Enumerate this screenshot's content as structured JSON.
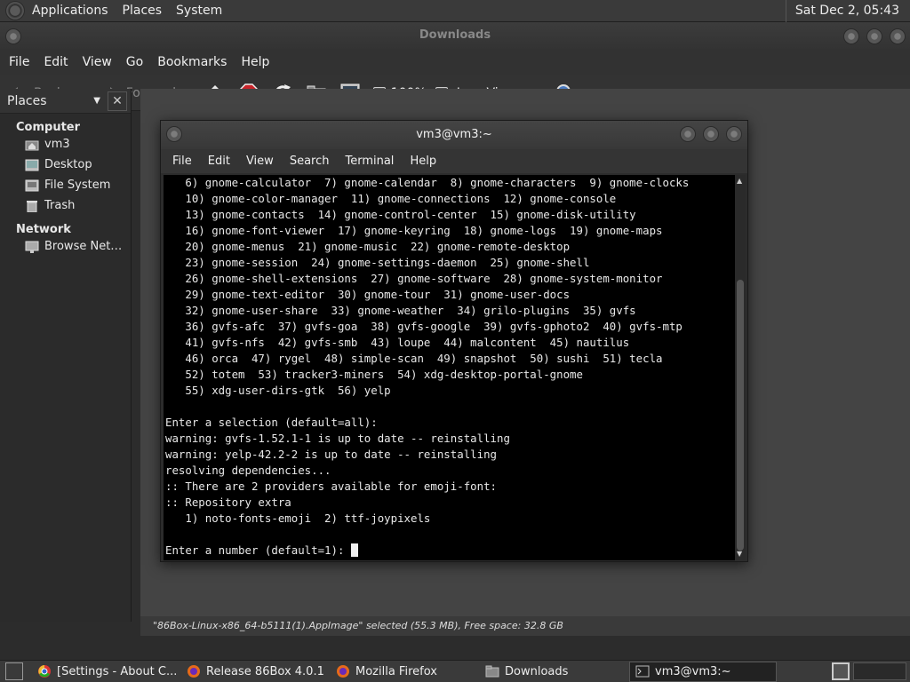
{
  "top_panel": {
    "menus": [
      "Applications",
      "Places",
      "System"
    ],
    "clock": "Sat Dec 2, 05:43"
  },
  "file_manager": {
    "title": "Downloads",
    "menus": [
      "File",
      "Edit",
      "View",
      "Go",
      "Bookmarks",
      "Help"
    ],
    "toolbar": {
      "back": "Back",
      "forward": "Forward",
      "zoom": "100%",
      "view_mode": "Icon View"
    },
    "side": {
      "header": "Places",
      "cat_computer": "Computer",
      "cat_network": "Network",
      "items": [
        "vm3",
        "Desktop",
        "File System",
        "Trash"
      ],
      "network_items": [
        "Browse Net…"
      ]
    },
    "status": "\"86Box-Linux-x86_64-b5111(1).AppImage\" selected (55.3 MB), Free space: 32.8 GB"
  },
  "terminal": {
    "title": "vm3@vm3:~",
    "menus": [
      "File",
      "Edit",
      "View",
      "Search",
      "Terminal",
      "Help"
    ],
    "lines": [
      "   6) gnome-calculator  7) gnome-calendar  8) gnome-characters  9) gnome-clocks",
      "   10) gnome-color-manager  11) gnome-connections  12) gnome-console",
      "   13) gnome-contacts  14) gnome-control-center  15) gnome-disk-utility",
      "   16) gnome-font-viewer  17) gnome-keyring  18) gnome-logs  19) gnome-maps",
      "   20) gnome-menus  21) gnome-music  22) gnome-remote-desktop",
      "   23) gnome-session  24) gnome-settings-daemon  25) gnome-shell",
      "   26) gnome-shell-extensions  27) gnome-software  28) gnome-system-monitor",
      "   29) gnome-text-editor  30) gnome-tour  31) gnome-user-docs",
      "   32) gnome-user-share  33) gnome-weather  34) grilo-plugins  35) gvfs",
      "   36) gvfs-afc  37) gvfs-goa  38) gvfs-google  39) gvfs-gphoto2  40) gvfs-mtp",
      "   41) gvfs-nfs  42) gvfs-smb  43) loupe  44) malcontent  45) nautilus",
      "   46) orca  47) rygel  48) simple-scan  49) snapshot  50) sushi  51) tecla",
      "   52) totem  53) tracker3-miners  54) xdg-desktop-portal-gnome",
      "   55) xdg-user-dirs-gtk  56) yelp",
      "",
      "Enter a selection (default=all):",
      "warning: gvfs-1.52.1-1 is up to date -- reinstalling",
      "warning: yelp-42.2-2 is up to date -- reinstalling",
      "resolving dependencies...",
      ":: There are 2 providers available for emoji-font:",
      ":: Repository extra",
      "   1) noto-fonts-emoji  2) ttf-joypixels",
      ""
    ],
    "prompt": "Enter a number (default=1): "
  },
  "taskbar": {
    "tasks": [
      {
        "label": "[Settings - About C...",
        "icon": "chrome-icon"
      },
      {
        "label": "Release 86Box 4.0.1 ...",
        "icon": "firefox-icon"
      },
      {
        "label": "Mozilla Firefox",
        "icon": "firefox-icon"
      },
      {
        "label": "Downloads",
        "icon": "folder-icon"
      },
      {
        "label": "vm3@vm3:~",
        "icon": "terminal-icon"
      }
    ]
  }
}
